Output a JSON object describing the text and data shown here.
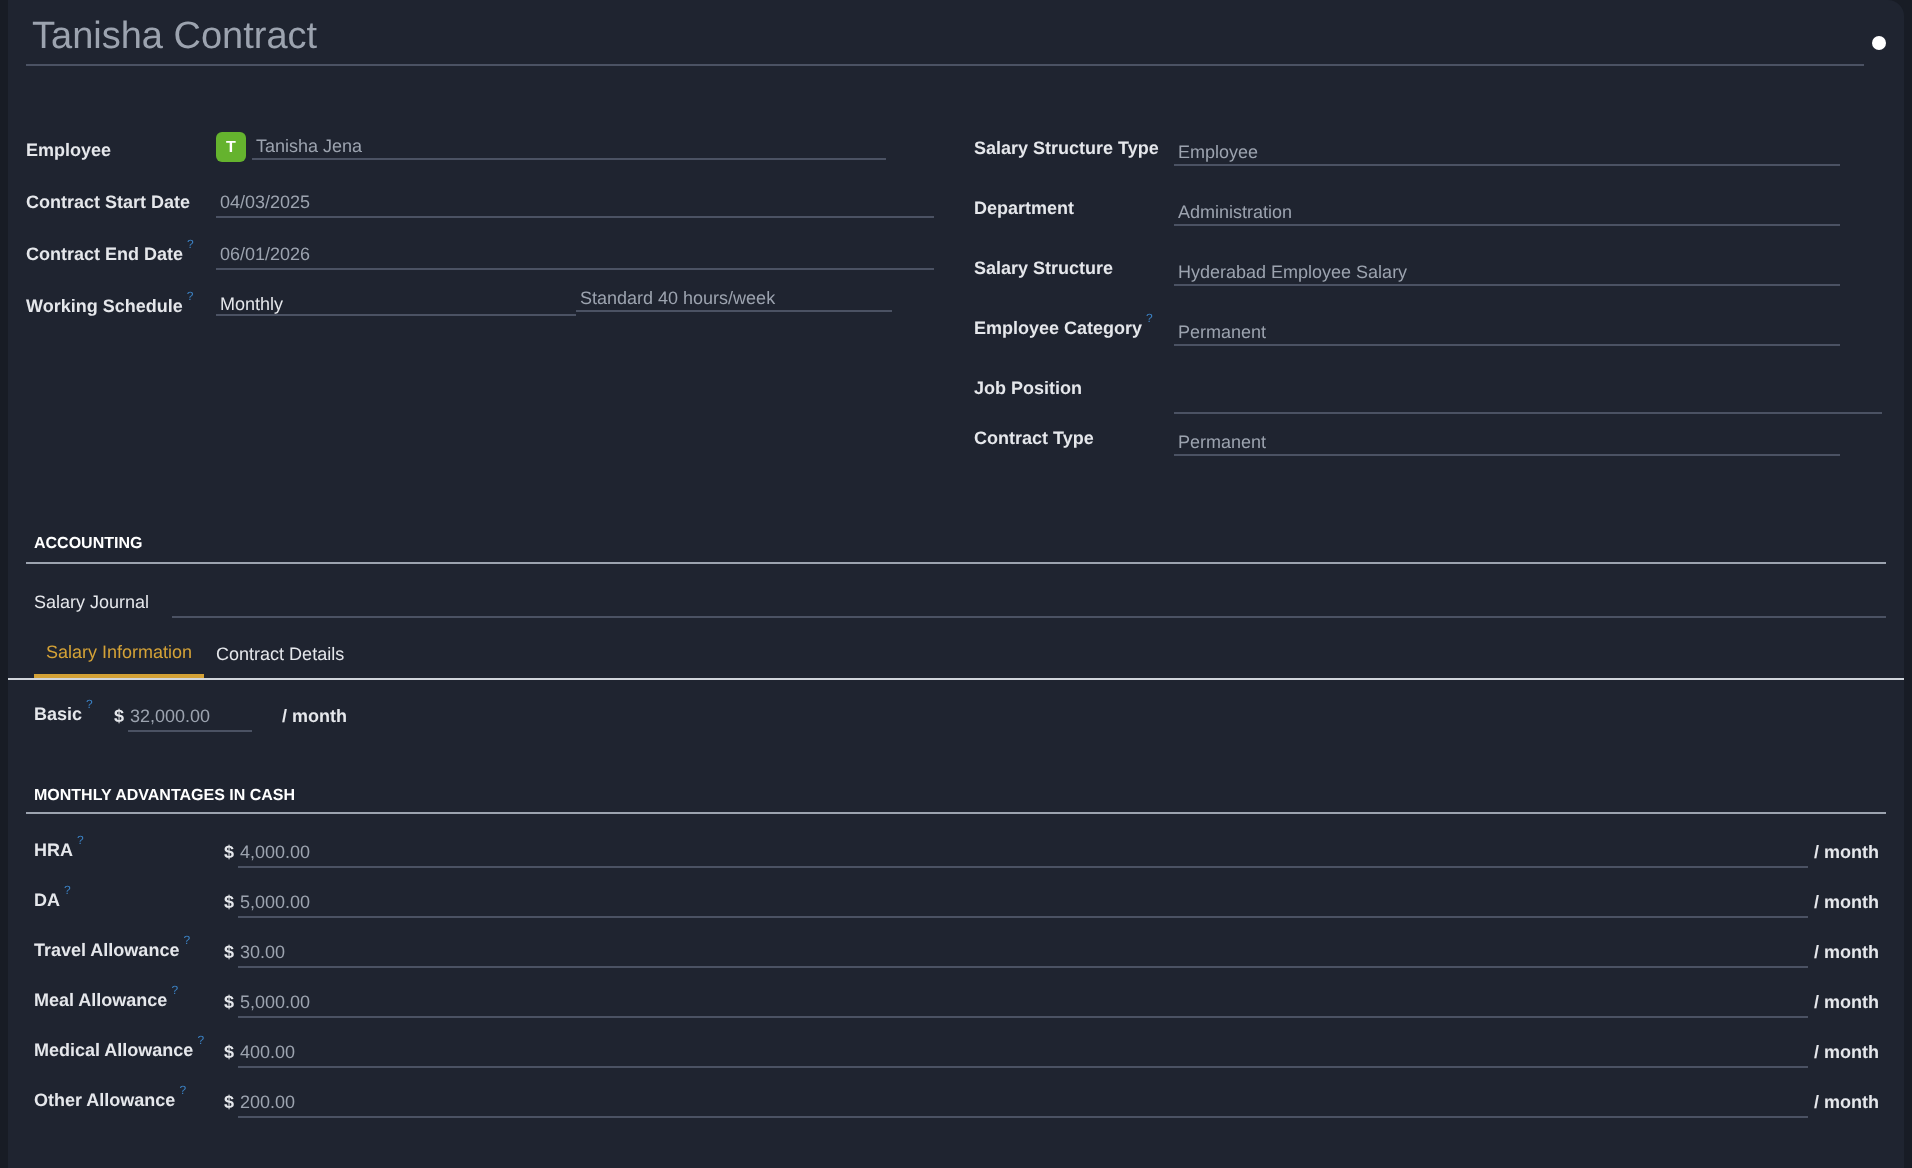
{
  "title": "Tanisha Contract",
  "left_fields": [
    {
      "label": "Employee",
      "value": "Tanisha Jena",
      "avatar": "T",
      "kind": "avatar"
    },
    {
      "label": "Contract Start Date",
      "value": "04/03/2025",
      "kind": "text"
    },
    {
      "label": "Contract End Date",
      "hint": "?",
      "value": "06/01/2026",
      "kind": "text"
    },
    {
      "label": "Working Schedule",
      "hint": "?",
      "value": "Monthly",
      "extra": "Standard 40 hours/week",
      "kind": "split"
    }
  ],
  "right_fields": [
    {
      "label": "Salary Structure Type",
      "value": "Employee"
    },
    {
      "label": "Department",
      "value": "Administration"
    },
    {
      "label": "Salary Structure",
      "value": "Hyderabad Employee Salary"
    },
    {
      "label": "Employee Category",
      "hint": "?",
      "value": "Permanent"
    },
    {
      "label": "Job Position"
    },
    {
      "label": "Contract Type",
      "value": "Permanent"
    }
  ],
  "accounting": {
    "heading": "ACCOUNTING",
    "label": "Salary Journal"
  },
  "tabs": [
    {
      "label": "Salary Information",
      "selected": true
    },
    {
      "label": "Contract Details",
      "selected": false
    }
  ],
  "basic": {
    "label": "Basic",
    "hint": "?",
    "currency": "$",
    "value": "32,000.00",
    "unit": "/ month"
  },
  "advantages": {
    "heading": "MONTHLY ADVANTAGES IN CASH",
    "rows": [
      {
        "label": "HRA",
        "hint": "?",
        "currency": "$",
        "value": "4,000.00",
        "unit": "/ month"
      },
      {
        "label": "DA",
        "hint": "?",
        "currency": "$",
        "value": "5,000.00",
        "unit": "/ month"
      },
      {
        "label": "Travel Allowance",
        "hint": "?",
        "currency": "$",
        "value": "30.00",
        "unit": "/ month"
      },
      {
        "label": "Meal Allowance",
        "hint": "?",
        "currency": "$",
        "value": "5,000.00",
        "unit": "/ month"
      },
      {
        "label": "Medical Allowance",
        "hint": "?",
        "currency": "$",
        "value": "400.00",
        "unit": "/ month"
      },
      {
        "label": "Other Allowance",
        "hint": "?",
        "currency": "$",
        "value": "200.00",
        "unit": "/ month"
      }
    ]
  }
}
